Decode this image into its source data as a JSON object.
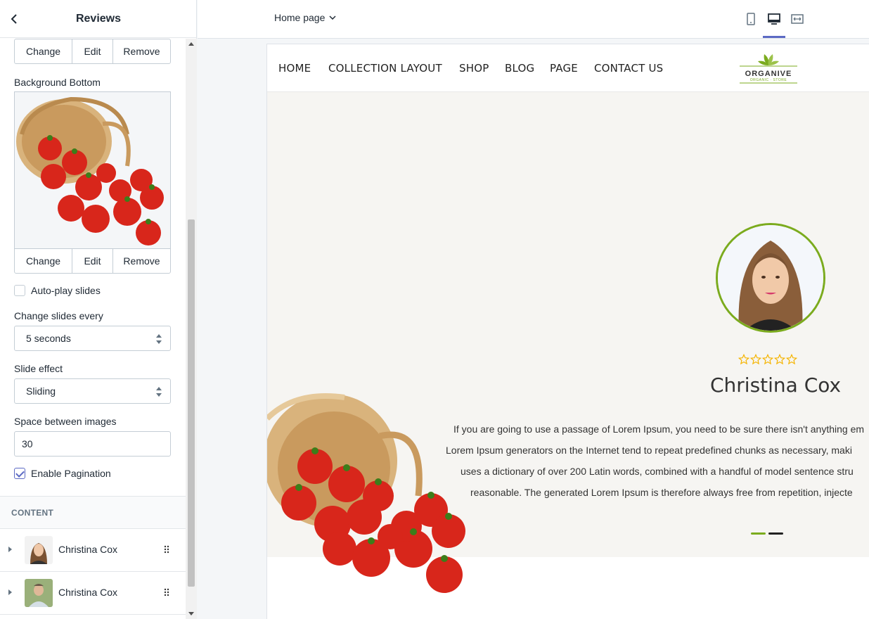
{
  "sidebar": {
    "title": "Reviews",
    "image_buttons": {
      "change": "Change",
      "edit": "Edit",
      "remove": "Remove"
    },
    "background_bottom_label": "Background Bottom",
    "autoplay_label": "Auto-play slides",
    "autoplay_checked": false,
    "change_slides_label": "Change slides every",
    "change_slides_value": "5 seconds",
    "slide_effect_label": "Slide effect",
    "slide_effect_value": "Sliding",
    "space_label": "Space between images",
    "space_value": "30",
    "pagination_label": "Enable Pagination",
    "pagination_checked": true,
    "content_heading": "CONTENT",
    "blocks": [
      {
        "name": "Christina Cox"
      },
      {
        "name": "Christina Cox"
      }
    ]
  },
  "topbar": {
    "page_selector": "Home page",
    "view_modes": [
      "mobile-icon",
      "desktop-icon",
      "fullwidth-icon"
    ],
    "active_view": "desktop-icon",
    "accent": "#5c6ac4"
  },
  "preview": {
    "nav": [
      "HOME",
      "COLLECTION LAYOUT",
      "SHOP",
      "BLOG",
      "PAGE",
      "CONTACT US"
    ],
    "logo": {
      "name": "ORGANIVE",
      "tagline": "ORGANIC · STORE"
    },
    "review": {
      "rating": 0,
      "max_rating": 5,
      "name": "Christina Cox",
      "lines": [
        "If you are going to use a passage of Lorem Ipsum, you need to be sure there isn't anything em",
        "Lorem Ipsum generators on the Internet tend to repeat predefined chunks as necessary, maki",
        "uses a dictionary of over 200 Latin words, combined with a handful of model sentence stru",
        "reasonable. The generated Lorem Ipsum is therefore always free from repetition, injecte"
      ]
    },
    "colors": {
      "brand_green": "#7bab1e",
      "star": "#f5b400"
    }
  }
}
